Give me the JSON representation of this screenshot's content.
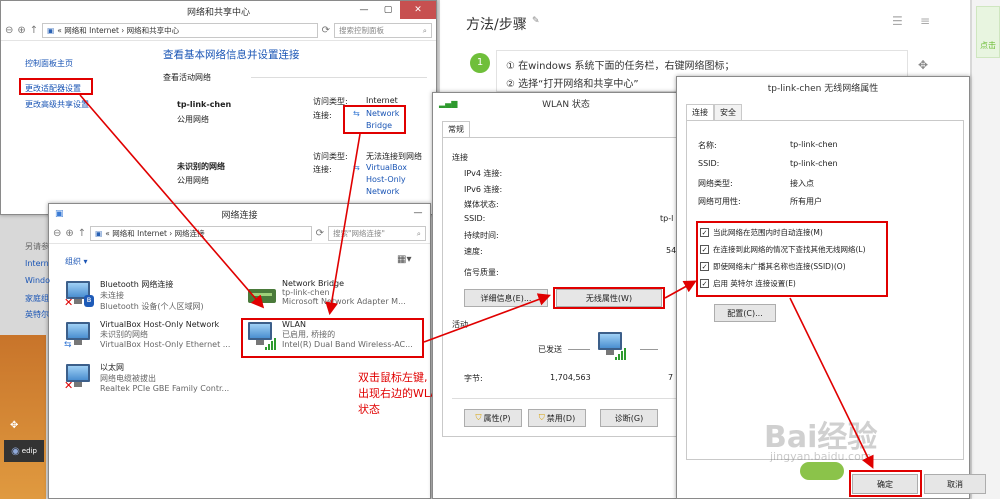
{
  "article": {
    "title": "方法/步骤",
    "step_number": "1",
    "step_line1": "① 在windows 系统下面的任务栏，右键网络图标；",
    "step_line2": "② 选择“打开网络和共享中心”",
    "right_label": "点击"
  },
  "network_center": {
    "title": "网络和共享中心",
    "breadcrumb": "«  网络和 Internet  ›  网络和共享中心",
    "search_placeholder": "搜索控制面板",
    "side_links": [
      "控制面板主页",
      "更改适配器设置",
      "更改高级共享设置"
    ],
    "side_bottom": [
      "另请参",
      "Intern",
      "Windo",
      "家庭组",
      "英特尔"
    ],
    "heading": "查看基本网络信息并设置连接",
    "subheading": "查看活动网络",
    "net1_name": "tp-link-chen",
    "net1_type": "公用网络",
    "net1_access_label": "访问类型:",
    "net1_access_value": "Internet",
    "net1_conn_label": "连接:",
    "net1_conn_value1": "Network",
    "net1_conn_value2": "Bridge",
    "net2_name": "未识别的网络",
    "net2_type": "公用网络",
    "net2_access_label": "访问类型:",
    "net2_access_value": "无法连接到网络",
    "net2_conn_label": "连接:",
    "net2_conn_value1": "VirtualBox",
    "net2_conn_value2": "Host-Only",
    "net2_conn_value3": "Network"
  },
  "net_connections": {
    "title": "网络连接",
    "breadcrumb": "«  网络和 Internet  ›  网络连接",
    "search_placeholder": "搜索\"网络连接\"",
    "organize": "组织 ▾",
    "items": [
      {
        "name": "Bluetooth 网络连接",
        "status": "未连接",
        "device": "Bluetooth 设备(个人区域网)"
      },
      {
        "name": "Network Bridge",
        "status": "tp-link-chen",
        "device": "Microsoft Network Adapter M..."
      },
      {
        "name": "VirtualBox Host-Only Network",
        "status": "未识别的网络",
        "device": "VirtualBox Host-Only Ethernet ..."
      },
      {
        "name": "WLAN",
        "status": "已启用, 桥接的",
        "device": "Intel(R) Dual Band Wireless-AC..."
      },
      {
        "name": "以太网",
        "status": "网络电缆被拔出",
        "device": "Realtek PCIe GBE Family Contr..."
      }
    ],
    "annotation": "双击鼠标左键,\n出现右边的WLAN\n状态"
  },
  "wlan_status": {
    "title": "WLAN 状态",
    "tab": "常规",
    "section_conn": "连接",
    "rows": [
      {
        "label": "IPv4 连接:",
        "value": ""
      },
      {
        "label": "IPv6 连接:",
        "value": ""
      },
      {
        "label": "媒体状态:",
        "value": ""
      },
      {
        "label": "SSID:",
        "value": "tp-l"
      },
      {
        "label": "持续时间:",
        "value": ""
      },
      {
        "label": "速度:",
        "value": "54"
      }
    ],
    "signal_label": "信号质量:",
    "details_button": "详细信息(E)...",
    "wireless_props_button": "无线属性(W)",
    "section_activity": "活动",
    "sent_label": "已发送",
    "bytes_label": "字节:",
    "bytes_sent": "1,704,563",
    "bytes_recv_partial": "7",
    "properties_button": "属性(P)",
    "disable_button": "禁用(D)",
    "diagnose_button": "诊断(G)"
  },
  "wireless_props": {
    "title": "tp-link-chen 无线网络属性",
    "tab_conn": "连接",
    "tab_security": "安全",
    "fields": [
      {
        "label": "名称:",
        "value": "tp-link-chen"
      },
      {
        "label": "SSID:",
        "value": "tp-link-chen"
      },
      {
        "label": "网络类型:",
        "value": "接入点"
      },
      {
        "label": "网络可用性:",
        "value": "所有用户"
      }
    ],
    "checkboxes": [
      "当此网络在范围内时自动连接(M)",
      "在连接到此网络的情况下查找其他无线网络(L)",
      "即使网络未广播其名称也连接(SSID)(O)",
      "启用 英特尔 连接设置(E)"
    ],
    "config_button": "配置(C)...",
    "ok_button": "确定",
    "cancel_button": "取消"
  },
  "taskbar": {
    "label": "edip"
  },
  "watermark": {
    "line1": "Bai经验",
    "line2": "jingyan.baidu.com"
  },
  "colors": {
    "accent_red": "#e00000",
    "link_blue": "#1a55b5",
    "step_green": "#6fbf3a"
  }
}
